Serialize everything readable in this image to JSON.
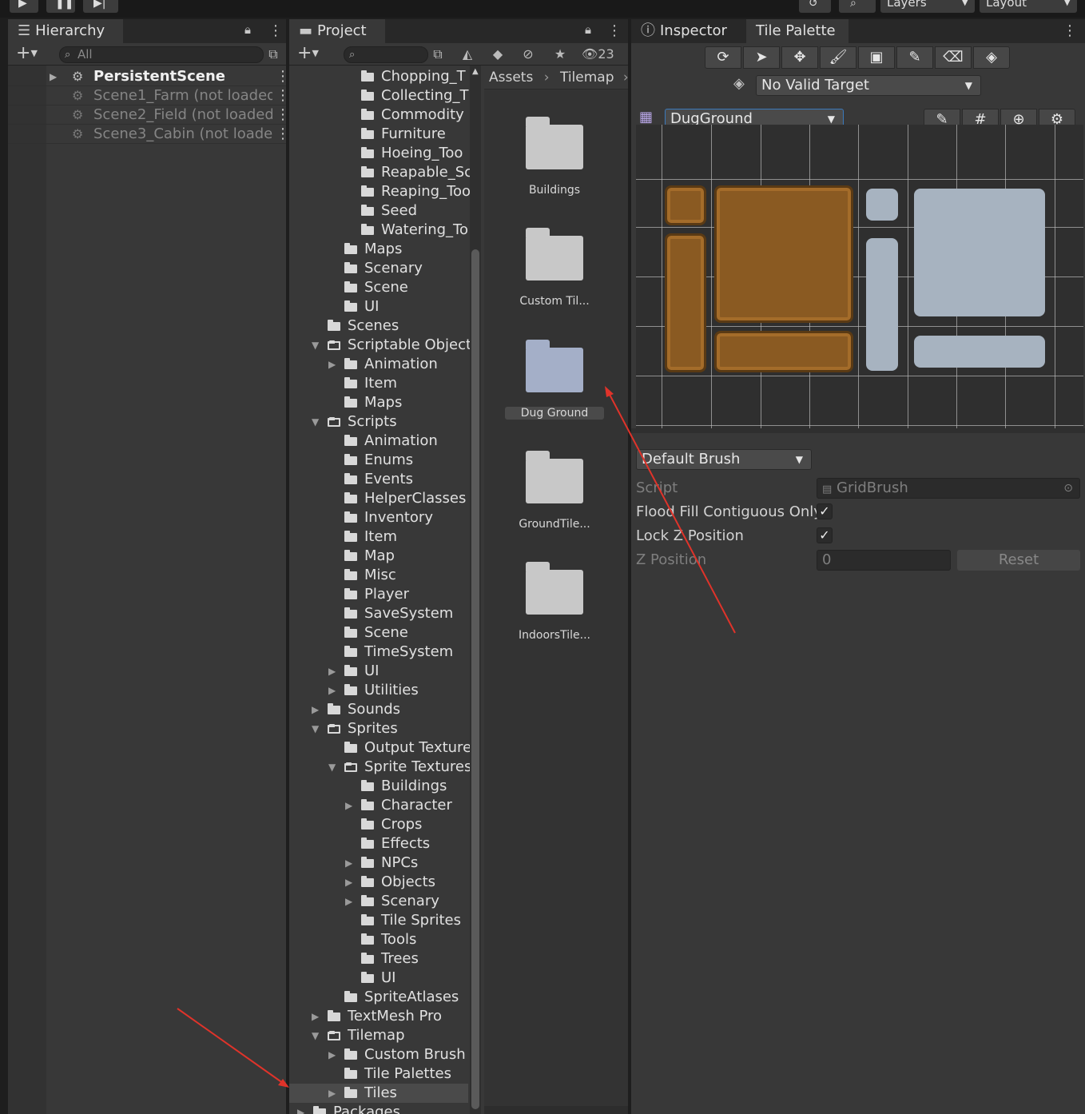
{
  "colors": {
    "accent": "#3a79bb",
    "annotation_arrow": "#e0332a",
    "panel": "#383838",
    "background": "#1e1e1e"
  },
  "toolbar": {
    "play_icon": "play-icon",
    "pause_icon": "pause-icon",
    "step_icon": "step-icon",
    "history_icon": "history-icon",
    "search_icon": "search-icon",
    "layers_label": "Layers",
    "layout_label": "Layout"
  },
  "hierarchy": {
    "tab_label": "Hierarchy",
    "search_placeholder": "All",
    "scenes": [
      {
        "name": "PersistentScene",
        "loaded": true
      },
      {
        "name": "Scene1_Farm (not loaded",
        "loaded": false
      },
      {
        "name": "Scene2_Field (not loaded",
        "loaded": false
      },
      {
        "name": "Scene3_Cabin (not loade",
        "loaded": false
      }
    ]
  },
  "project": {
    "tab_label": "Project",
    "hidden_count": "23",
    "tree": [
      {
        "label": "Chopping_T",
        "depth": 3,
        "arrow": "",
        "open": false
      },
      {
        "label": "Collecting_T",
        "depth": 3,
        "arrow": "",
        "open": false
      },
      {
        "label": "Commodity",
        "depth": 3,
        "arrow": "",
        "open": false
      },
      {
        "label": "Furniture",
        "depth": 3,
        "arrow": "",
        "open": false
      },
      {
        "label": "Hoeing_Too",
        "depth": 3,
        "arrow": "",
        "open": false
      },
      {
        "label": "Reapable_Sc",
        "depth": 3,
        "arrow": "",
        "open": false
      },
      {
        "label": "Reaping_Too",
        "depth": 3,
        "arrow": "",
        "open": false
      },
      {
        "label": "Seed",
        "depth": 3,
        "arrow": "",
        "open": false
      },
      {
        "label": "Watering_To",
        "depth": 3,
        "arrow": "",
        "open": false
      },
      {
        "label": "Maps",
        "depth": 2,
        "arrow": "",
        "open": false
      },
      {
        "label": "Scenary",
        "depth": 2,
        "arrow": "",
        "open": false
      },
      {
        "label": "Scene",
        "depth": 2,
        "arrow": "",
        "open": false
      },
      {
        "label": "UI",
        "depth": 2,
        "arrow": "",
        "open": false
      },
      {
        "label": "Scenes",
        "depth": 1,
        "arrow": "",
        "open": false
      },
      {
        "label": "Scriptable Object",
        "depth": 1,
        "arrow": "down",
        "open": true
      },
      {
        "label": "Animation",
        "depth": 2,
        "arrow": "right",
        "open": false
      },
      {
        "label": "Item",
        "depth": 2,
        "arrow": "",
        "open": false
      },
      {
        "label": "Maps",
        "depth": 2,
        "arrow": "",
        "open": false
      },
      {
        "label": "Scripts",
        "depth": 1,
        "arrow": "down",
        "open": true
      },
      {
        "label": "Animation",
        "depth": 2,
        "arrow": "",
        "open": false
      },
      {
        "label": "Enums",
        "depth": 2,
        "arrow": "",
        "open": false
      },
      {
        "label": "Events",
        "depth": 2,
        "arrow": "",
        "open": false
      },
      {
        "label": "HelperClasses",
        "depth": 2,
        "arrow": "",
        "open": false
      },
      {
        "label": "Inventory",
        "depth": 2,
        "arrow": "",
        "open": false
      },
      {
        "label": "Item",
        "depth": 2,
        "arrow": "",
        "open": false
      },
      {
        "label": "Map",
        "depth": 2,
        "arrow": "",
        "open": false
      },
      {
        "label": "Misc",
        "depth": 2,
        "arrow": "",
        "open": false
      },
      {
        "label": "Player",
        "depth": 2,
        "arrow": "",
        "open": false
      },
      {
        "label": "SaveSystem",
        "depth": 2,
        "arrow": "",
        "open": false
      },
      {
        "label": "Scene",
        "depth": 2,
        "arrow": "",
        "open": false
      },
      {
        "label": "TimeSystem",
        "depth": 2,
        "arrow": "",
        "open": false
      },
      {
        "label": "UI",
        "depth": 2,
        "arrow": "right",
        "open": false
      },
      {
        "label": "Utilities",
        "depth": 2,
        "arrow": "right",
        "open": false
      },
      {
        "label": "Sounds",
        "depth": 1,
        "arrow": "right",
        "open": false
      },
      {
        "label": "Sprites",
        "depth": 1,
        "arrow": "down",
        "open": true
      },
      {
        "label": "Output Textures",
        "depth": 2,
        "arrow": "",
        "open": false
      },
      {
        "label": "Sprite Textures",
        "depth": 2,
        "arrow": "down",
        "open": true
      },
      {
        "label": "Buildings",
        "depth": 3,
        "arrow": "",
        "open": false
      },
      {
        "label": "Character",
        "depth": 3,
        "arrow": "right",
        "open": false
      },
      {
        "label": "Crops",
        "depth": 3,
        "arrow": "",
        "open": false
      },
      {
        "label": "Effects",
        "depth": 3,
        "arrow": "",
        "open": false
      },
      {
        "label": "NPCs",
        "depth": 3,
        "arrow": "right",
        "open": false
      },
      {
        "label": "Objects",
        "depth": 3,
        "arrow": "right",
        "open": false
      },
      {
        "label": "Scenary",
        "depth": 3,
        "arrow": "right",
        "open": false
      },
      {
        "label": "Tile Sprites",
        "depth": 3,
        "arrow": "",
        "open": false
      },
      {
        "label": "Tools",
        "depth": 3,
        "arrow": "",
        "open": false
      },
      {
        "label": "Trees",
        "depth": 3,
        "arrow": "",
        "open": false
      },
      {
        "label": "UI",
        "depth": 3,
        "arrow": "",
        "open": false
      },
      {
        "label": "SpriteAtlases",
        "depth": 2,
        "arrow": "",
        "open": false
      },
      {
        "label": "TextMesh Pro",
        "depth": 1,
        "arrow": "right",
        "open": false
      },
      {
        "label": "Tilemap",
        "depth": 1,
        "arrow": "down",
        "open": true
      },
      {
        "label": "Custom Brush S",
        "depth": 2,
        "arrow": "right",
        "open": false
      },
      {
        "label": "Tile Palettes",
        "depth": 2,
        "arrow": "",
        "open": false
      },
      {
        "label": "Tiles",
        "depth": 2,
        "arrow": "right",
        "open": false,
        "selected": true
      },
      {
        "label": "Packages",
        "depth": 0,
        "arrow": "right",
        "open": false
      }
    ],
    "breadcrumb": [
      "Assets",
      "Tilemap"
    ],
    "grid_items": [
      {
        "label": "Buildings",
        "selected": false
      },
      {
        "label": "Custom Til...",
        "selected": false
      },
      {
        "label": "Dug Ground",
        "selected": true
      },
      {
        "label": "GroundTile...",
        "selected": false
      },
      {
        "label": "IndoorsTile...",
        "selected": false
      }
    ]
  },
  "inspector": {
    "tab_inspector": "Inspector",
    "tab_tile_palette": "Tile Palette",
    "tools": [
      "rotate-icon",
      "select-arrow-icon",
      "move-icon",
      "brush-icon",
      "box-fill-icon",
      "picker-icon",
      "eraser-icon",
      "fill-bucket-icon"
    ],
    "target": "No Valid Target",
    "palette": "DugGround",
    "palette_tools": [
      "edit-pencil-icon",
      "grid-icon",
      "gizmo-icon",
      "settings-icon"
    ],
    "brush": "Default Brush",
    "props": {
      "script_label": "Script",
      "script_value": "GridBrush",
      "flood_label": "Flood Fill Contiguous Only",
      "flood_checked": true,
      "lockz_label": "Lock Z Position",
      "lockz_checked": true,
      "zpos_label": "Z Position",
      "zpos_value": "0",
      "reset_label": "Reset"
    }
  }
}
